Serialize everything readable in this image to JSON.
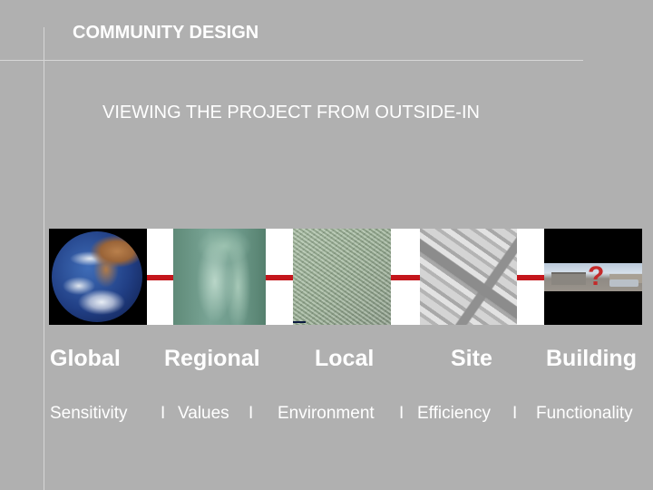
{
  "header": {
    "title": "COMMUNITY DESIGN",
    "subtitle": "VIEWING THE PROJECT FROM OUTSIDE-IN"
  },
  "strip": {
    "images": [
      {
        "name": "earth-image",
        "depicts": "Earth from space"
      },
      {
        "name": "regional-aerial-image",
        "depicts": "Regional aerial photo"
      },
      {
        "name": "local-aerial-image",
        "depicts": "Local aerial photo"
      },
      {
        "name": "site-aerial-image",
        "depicts": "Site aerial photo"
      },
      {
        "name": "building-photo-image",
        "depicts": "Building panorama with question mark"
      }
    ],
    "question_mark": "?",
    "connector_color": "#c4161c"
  },
  "scales": [
    {
      "label": "Global",
      "value": "Sensitivity"
    },
    {
      "label": "Regional",
      "value": "Values"
    },
    {
      "label": "Local",
      "value": "Environment"
    },
    {
      "label": "Site",
      "value": "Efficiency"
    },
    {
      "label": "Building",
      "value": "Functionality"
    }
  ],
  "separator": "I",
  "colors": {
    "background": "#b0b0b0",
    "text": "#ffffff",
    "rule": "#d6d6d6"
  }
}
